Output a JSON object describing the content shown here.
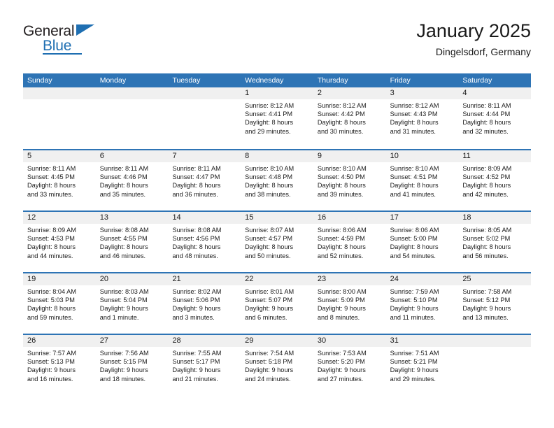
{
  "logo": {
    "word1": "General",
    "word2": "Blue",
    "triangle_color": "#1f6fb2",
    "text_color": "#231f20"
  },
  "header": {
    "title": "January 2025",
    "subtitle": "Dingelsdorf, Germany"
  },
  "theme": {
    "header_blue": "#2e74b5",
    "day_band_gray": "#f0f0f0",
    "text": "#1a1a1a"
  },
  "weekdays": [
    "Sunday",
    "Monday",
    "Tuesday",
    "Wednesday",
    "Thursday",
    "Friday",
    "Saturday"
  ],
  "weeks": [
    [
      {
        "day": "",
        "empty": true,
        "sunrise": "",
        "sunset": "",
        "daylight_line1": "",
        "daylight_line2": ""
      },
      {
        "day": "",
        "empty": true,
        "sunrise": "",
        "sunset": "",
        "daylight_line1": "",
        "daylight_line2": ""
      },
      {
        "day": "",
        "empty": true,
        "sunrise": "",
        "sunset": "",
        "daylight_line1": "",
        "daylight_line2": ""
      },
      {
        "day": "1",
        "empty": false,
        "sunrise": "Sunrise: 8:12 AM",
        "sunset": "Sunset: 4:41 PM",
        "daylight_line1": "Daylight: 8 hours",
        "daylight_line2": "and 29 minutes."
      },
      {
        "day": "2",
        "empty": false,
        "sunrise": "Sunrise: 8:12 AM",
        "sunset": "Sunset: 4:42 PM",
        "daylight_line1": "Daylight: 8 hours",
        "daylight_line2": "and 30 minutes."
      },
      {
        "day": "3",
        "empty": false,
        "sunrise": "Sunrise: 8:12 AM",
        "sunset": "Sunset: 4:43 PM",
        "daylight_line1": "Daylight: 8 hours",
        "daylight_line2": "and 31 minutes."
      },
      {
        "day": "4",
        "empty": false,
        "sunrise": "Sunrise: 8:11 AM",
        "sunset": "Sunset: 4:44 PM",
        "daylight_line1": "Daylight: 8 hours",
        "daylight_line2": "and 32 minutes."
      }
    ],
    [
      {
        "day": "5",
        "empty": false,
        "sunrise": "Sunrise: 8:11 AM",
        "sunset": "Sunset: 4:45 PM",
        "daylight_line1": "Daylight: 8 hours",
        "daylight_line2": "and 33 minutes."
      },
      {
        "day": "6",
        "empty": false,
        "sunrise": "Sunrise: 8:11 AM",
        "sunset": "Sunset: 4:46 PM",
        "daylight_line1": "Daylight: 8 hours",
        "daylight_line2": "and 35 minutes."
      },
      {
        "day": "7",
        "empty": false,
        "sunrise": "Sunrise: 8:11 AM",
        "sunset": "Sunset: 4:47 PM",
        "daylight_line1": "Daylight: 8 hours",
        "daylight_line2": "and 36 minutes."
      },
      {
        "day": "8",
        "empty": false,
        "sunrise": "Sunrise: 8:10 AM",
        "sunset": "Sunset: 4:48 PM",
        "daylight_line1": "Daylight: 8 hours",
        "daylight_line2": "and 38 minutes."
      },
      {
        "day": "9",
        "empty": false,
        "sunrise": "Sunrise: 8:10 AM",
        "sunset": "Sunset: 4:50 PM",
        "daylight_line1": "Daylight: 8 hours",
        "daylight_line2": "and 39 minutes."
      },
      {
        "day": "10",
        "empty": false,
        "sunrise": "Sunrise: 8:10 AM",
        "sunset": "Sunset: 4:51 PM",
        "daylight_line1": "Daylight: 8 hours",
        "daylight_line2": "and 41 minutes."
      },
      {
        "day": "11",
        "empty": false,
        "sunrise": "Sunrise: 8:09 AM",
        "sunset": "Sunset: 4:52 PM",
        "daylight_line1": "Daylight: 8 hours",
        "daylight_line2": "and 42 minutes."
      }
    ],
    [
      {
        "day": "12",
        "empty": false,
        "sunrise": "Sunrise: 8:09 AM",
        "sunset": "Sunset: 4:53 PM",
        "daylight_line1": "Daylight: 8 hours",
        "daylight_line2": "and 44 minutes."
      },
      {
        "day": "13",
        "empty": false,
        "sunrise": "Sunrise: 8:08 AM",
        "sunset": "Sunset: 4:55 PM",
        "daylight_line1": "Daylight: 8 hours",
        "daylight_line2": "and 46 minutes."
      },
      {
        "day": "14",
        "empty": false,
        "sunrise": "Sunrise: 8:08 AM",
        "sunset": "Sunset: 4:56 PM",
        "daylight_line1": "Daylight: 8 hours",
        "daylight_line2": "and 48 minutes."
      },
      {
        "day": "15",
        "empty": false,
        "sunrise": "Sunrise: 8:07 AM",
        "sunset": "Sunset: 4:57 PM",
        "daylight_line1": "Daylight: 8 hours",
        "daylight_line2": "and 50 minutes."
      },
      {
        "day": "16",
        "empty": false,
        "sunrise": "Sunrise: 8:06 AM",
        "sunset": "Sunset: 4:59 PM",
        "daylight_line1": "Daylight: 8 hours",
        "daylight_line2": "and 52 minutes."
      },
      {
        "day": "17",
        "empty": false,
        "sunrise": "Sunrise: 8:06 AM",
        "sunset": "Sunset: 5:00 PM",
        "daylight_line1": "Daylight: 8 hours",
        "daylight_line2": "and 54 minutes."
      },
      {
        "day": "18",
        "empty": false,
        "sunrise": "Sunrise: 8:05 AM",
        "sunset": "Sunset: 5:02 PM",
        "daylight_line1": "Daylight: 8 hours",
        "daylight_line2": "and 56 minutes."
      }
    ],
    [
      {
        "day": "19",
        "empty": false,
        "sunrise": "Sunrise: 8:04 AM",
        "sunset": "Sunset: 5:03 PM",
        "daylight_line1": "Daylight: 8 hours",
        "daylight_line2": "and 59 minutes."
      },
      {
        "day": "20",
        "empty": false,
        "sunrise": "Sunrise: 8:03 AM",
        "sunset": "Sunset: 5:04 PM",
        "daylight_line1": "Daylight: 9 hours",
        "daylight_line2": "and 1 minute."
      },
      {
        "day": "21",
        "empty": false,
        "sunrise": "Sunrise: 8:02 AM",
        "sunset": "Sunset: 5:06 PM",
        "daylight_line1": "Daylight: 9 hours",
        "daylight_line2": "and 3 minutes."
      },
      {
        "day": "22",
        "empty": false,
        "sunrise": "Sunrise: 8:01 AM",
        "sunset": "Sunset: 5:07 PM",
        "daylight_line1": "Daylight: 9 hours",
        "daylight_line2": "and 6 minutes."
      },
      {
        "day": "23",
        "empty": false,
        "sunrise": "Sunrise: 8:00 AM",
        "sunset": "Sunset: 5:09 PM",
        "daylight_line1": "Daylight: 9 hours",
        "daylight_line2": "and 8 minutes."
      },
      {
        "day": "24",
        "empty": false,
        "sunrise": "Sunrise: 7:59 AM",
        "sunset": "Sunset: 5:10 PM",
        "daylight_line1": "Daylight: 9 hours",
        "daylight_line2": "and 11 minutes."
      },
      {
        "day": "25",
        "empty": false,
        "sunrise": "Sunrise: 7:58 AM",
        "sunset": "Sunset: 5:12 PM",
        "daylight_line1": "Daylight: 9 hours",
        "daylight_line2": "and 13 minutes."
      }
    ],
    [
      {
        "day": "26",
        "empty": false,
        "sunrise": "Sunrise: 7:57 AM",
        "sunset": "Sunset: 5:13 PM",
        "daylight_line1": "Daylight: 9 hours",
        "daylight_line2": "and 16 minutes."
      },
      {
        "day": "27",
        "empty": false,
        "sunrise": "Sunrise: 7:56 AM",
        "sunset": "Sunset: 5:15 PM",
        "daylight_line1": "Daylight: 9 hours",
        "daylight_line2": "and 18 minutes."
      },
      {
        "day": "28",
        "empty": false,
        "sunrise": "Sunrise: 7:55 AM",
        "sunset": "Sunset: 5:17 PM",
        "daylight_line1": "Daylight: 9 hours",
        "daylight_line2": "and 21 minutes."
      },
      {
        "day": "29",
        "empty": false,
        "sunrise": "Sunrise: 7:54 AM",
        "sunset": "Sunset: 5:18 PM",
        "daylight_line1": "Daylight: 9 hours",
        "daylight_line2": "and 24 minutes."
      },
      {
        "day": "30",
        "empty": false,
        "sunrise": "Sunrise: 7:53 AM",
        "sunset": "Sunset: 5:20 PM",
        "daylight_line1": "Daylight: 9 hours",
        "daylight_line2": "and 27 minutes."
      },
      {
        "day": "31",
        "empty": false,
        "sunrise": "Sunrise: 7:51 AM",
        "sunset": "Sunset: 5:21 PM",
        "daylight_line1": "Daylight: 9 hours",
        "daylight_line2": "and 29 minutes."
      },
      {
        "day": "",
        "empty": true,
        "sunrise": "",
        "sunset": "",
        "daylight_line1": "",
        "daylight_line2": ""
      }
    ]
  ]
}
